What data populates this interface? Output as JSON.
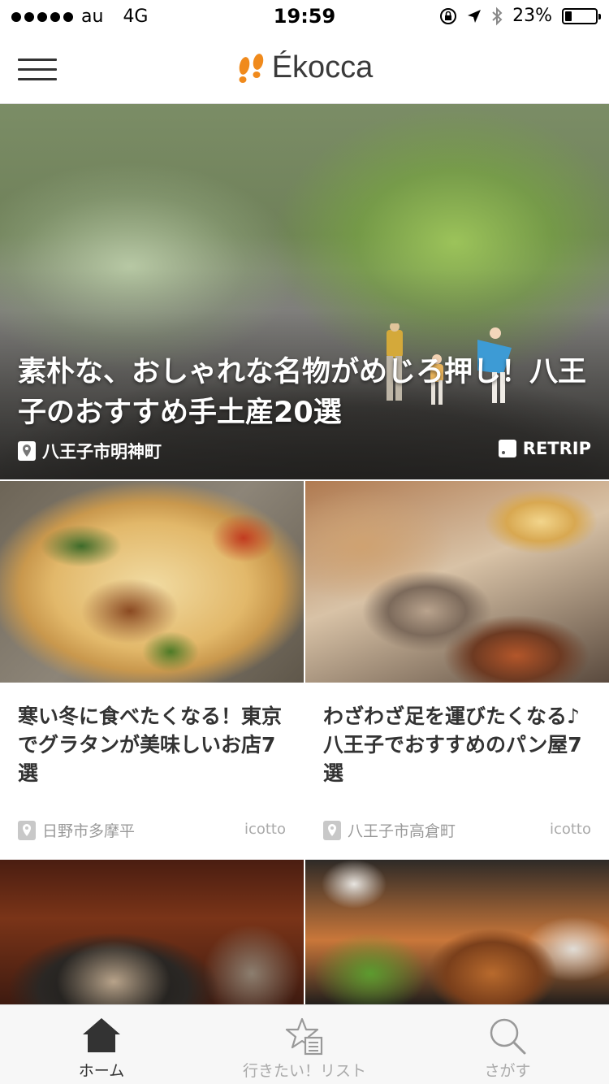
{
  "status_bar": {
    "carrier": "au",
    "network": "4G",
    "time": "19:59",
    "battery": "23%",
    "battery_level": 0.23
  },
  "header": {
    "app_name": "Ékocca",
    "logo_color": "#f08a1c"
  },
  "hero": {
    "title": "素朴な、おしゃれな名物がめじろ押し！八王子のおすすめ手土産20選",
    "location": "八王子市明神町",
    "source": "RETRIP"
  },
  "cards": [
    {
      "title": "寒い冬に食べたくなる！東京でグラタンが美味しいお店7選",
      "location": "日野市多摩平",
      "source": "icotto"
    },
    {
      "title": "わざわざ足を運びたくなる♪八王子でおすすめのパン屋7選",
      "location": "八王子市高倉町",
      "source": "icotto"
    }
  ],
  "tabs": [
    {
      "label": "ホーム",
      "icon": "home-icon",
      "active": true
    },
    {
      "label": "行きたい！リスト",
      "icon": "star-list-icon",
      "active": false
    },
    {
      "label": "さがす",
      "icon": "search-icon",
      "active": false
    }
  ]
}
